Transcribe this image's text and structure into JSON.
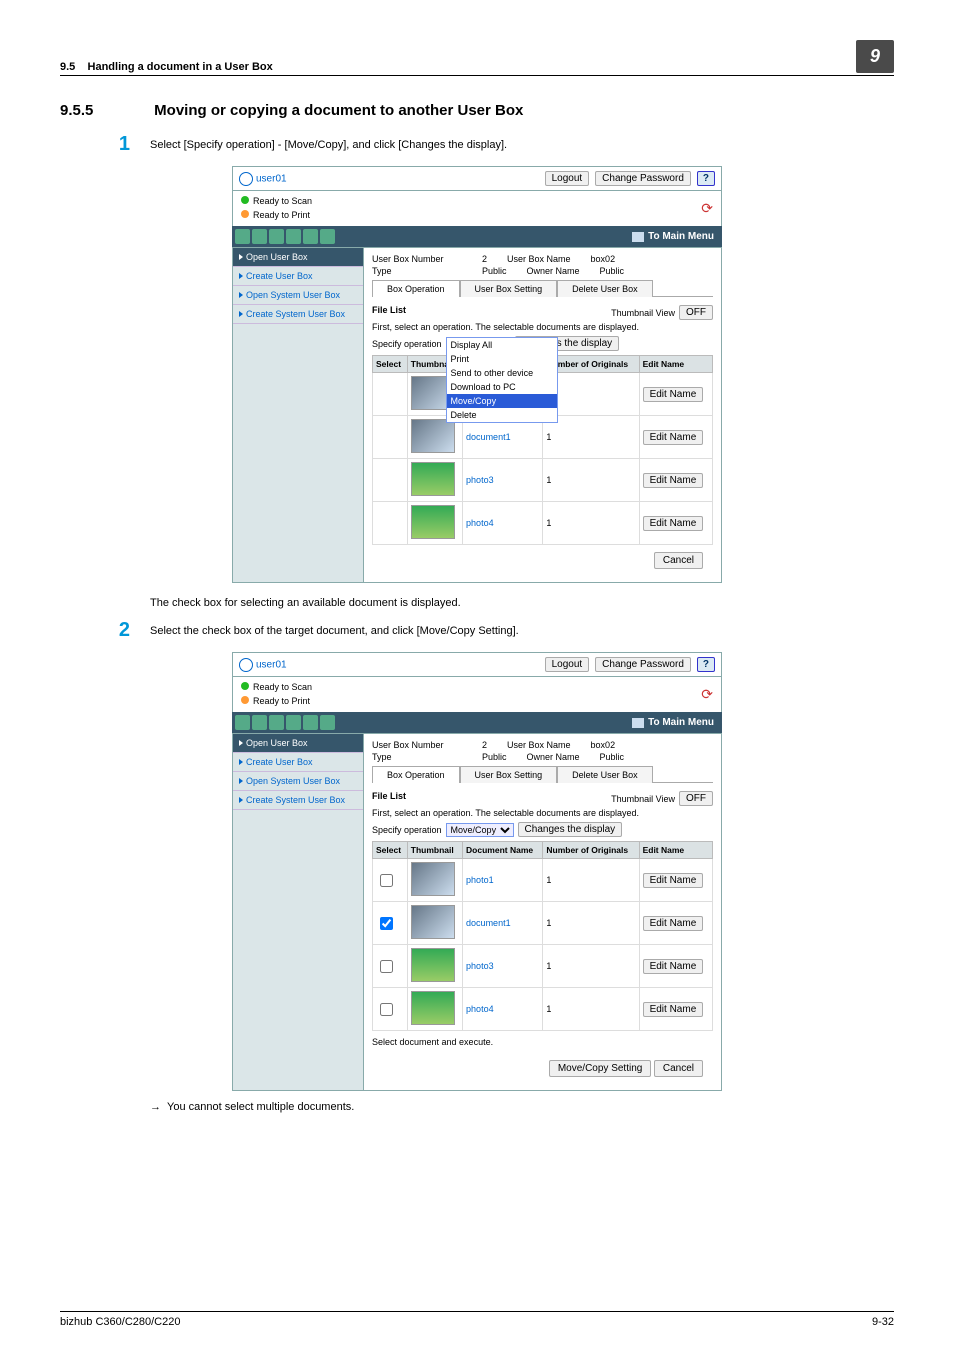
{
  "header": {
    "section_no": "9.5",
    "section_title": "Handling a document in a User Box",
    "chapter": "9"
  },
  "title": {
    "num": "9.5.5",
    "text": "Moving or copying a document to another User Box"
  },
  "steps": [
    {
      "n": "1",
      "text": "Select [Specify operation] - [Move/Copy], and click [Changes the display]."
    },
    {
      "n": "2",
      "text": "Select the check box of the target document, and click [Move/Copy Setting]."
    }
  ],
  "para1": "The check box for selecting an available document is displayed.",
  "arrow_note": "You cannot select multiple documents.",
  "shot": {
    "user": "user01",
    "logout": "Logout",
    "changepw": "Change Password",
    "help": "?",
    "status": {
      "scan": "Ready to Scan",
      "print": "Ready to Print"
    },
    "tomain": "To Main Menu",
    "sidebar": [
      "Open User Box",
      "Create User Box",
      "Open System User Box",
      "Create System User Box"
    ],
    "info": {
      "boxnum_l": "User Box Number",
      "boxnum_v": "2",
      "boxname_l": "User Box Name",
      "boxname_v": "box02",
      "type_l": "Type",
      "type_v": "Public",
      "owner_l": "Owner Name",
      "owner_v": "Public"
    },
    "tabs": [
      "Box Operation",
      "User Box Setting",
      "Delete User Box"
    ],
    "filelist": "File List",
    "thumb": "Thumbnail View",
    "off": "OFF",
    "firstsel": "First, select an operation. The selectable documents are displayed.",
    "specop": "Specify operation",
    "disp_all": "Display All",
    "changes": "Changes the display",
    "cols": {
      "c1": "Select",
      "c2": "Thumbnail",
      "c3": "Document Name",
      "c4": "Number of Originals",
      "c5": "Edit Name"
    },
    "dd": [
      "Display All",
      "Print",
      "Send to other device",
      "Download to PC",
      "Move/Copy",
      "Delete"
    ],
    "docs": [
      {
        "name": "photo1",
        "num": "1"
      },
      {
        "name": "document1",
        "num": "1"
      },
      {
        "name": "photo3",
        "num": "1"
      },
      {
        "name": "photo4",
        "num": "1"
      }
    ],
    "edit": "Edit Name",
    "cancel": "Cancel",
    "movecopy_sel": "Move/Copy",
    "seldoc": "Select document and execute.",
    "mcs": "Move/Copy Setting"
  },
  "footer": {
    "model": "bizhub C360/C280/C220",
    "page": "9-32"
  }
}
